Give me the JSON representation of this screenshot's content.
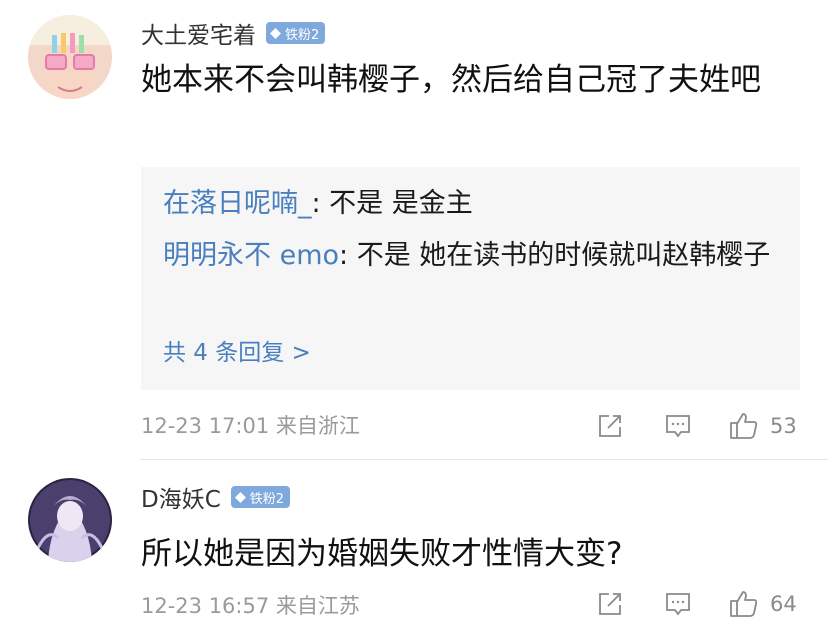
{
  "comments": [
    {
      "username": "大土爱宅着",
      "badge": "铁粉2",
      "text": "她本来不会叫韩樱子，然后给自己冠了夫姓吧",
      "replies": [
        {
          "name": "在落日呢喃_",
          "text": ": 不是 是金主"
        },
        {
          "name": "明明永不 emo",
          "text": ": 不是 她在读书的时候就叫赵韩樱子"
        }
      ],
      "more_replies": "共 4 条回复 >",
      "meta": "12-23 17:01 来自浙江",
      "likes": "53"
    },
    {
      "username": "D海妖C",
      "badge": "铁粉2",
      "text": "所以她是因为婚姻失败才性情大变?",
      "meta": "12-23 16:57 来自江苏",
      "likes": "64"
    }
  ],
  "colors": {
    "link": "#4a7fbf",
    "badge": "#7fa8dd",
    "meta": "#9a9a9a",
    "reply_bg": "#f6f6f6"
  },
  "icons": {
    "share": "share-icon",
    "reply": "comment-icon",
    "like": "thumbs-up-icon",
    "badge": "diamond-icon"
  }
}
